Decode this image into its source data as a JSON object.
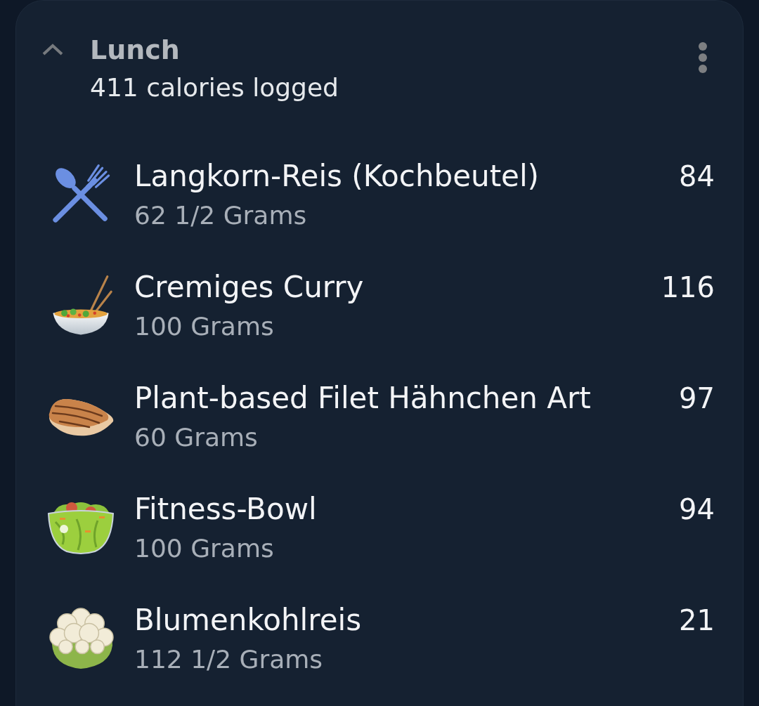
{
  "meal": {
    "title": "Lunch",
    "summary": "411 calories logged",
    "expanded": true
  },
  "items": [
    {
      "kind": "cutlery",
      "name": "Langkorn-Reis (Kochbeutel)",
      "serving": "62 1/2 Grams",
      "calories": "84"
    },
    {
      "kind": "noodle-bowl",
      "name": "Cremiges Curry",
      "serving": "100 Grams",
      "calories": "116"
    },
    {
      "kind": "grilled-chicken",
      "name": "Plant-based Filet Hähnchen Art",
      "serving": "60 Grams",
      "calories": "97"
    },
    {
      "kind": "salad-bowl",
      "name": "Fitness-Bowl",
      "serving": "100 Grams",
      "calories": "94"
    },
    {
      "kind": "cauliflower",
      "name": "Blumenkohlreis",
      "serving": "112 1/2 Grams",
      "calories": "21"
    }
  ]
}
